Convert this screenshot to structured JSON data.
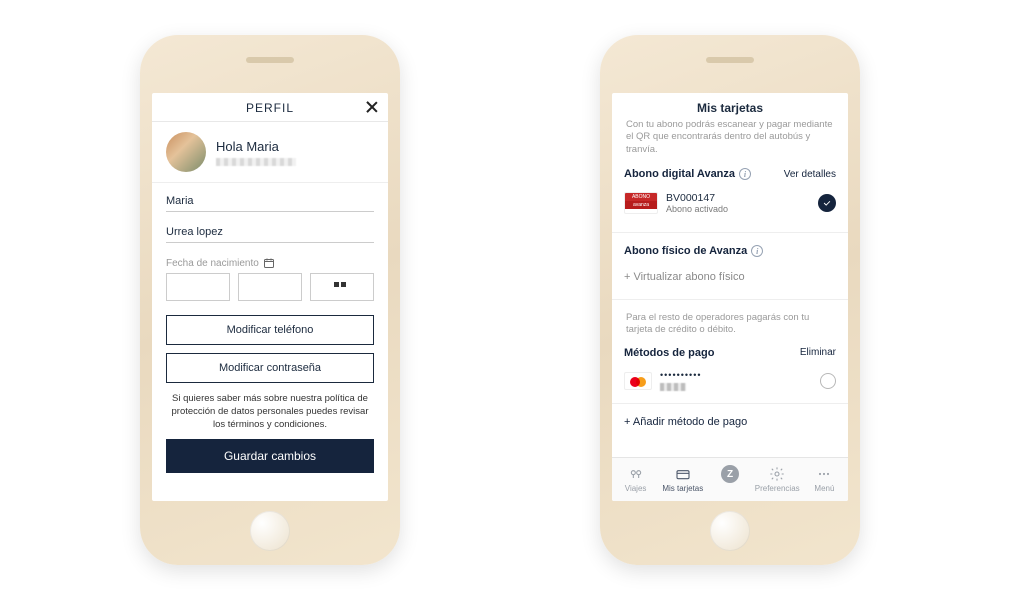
{
  "profile": {
    "title": "PERFIL",
    "greeting": "Hola Maria",
    "first_name": "Maria",
    "last_name": "Urrea lopez",
    "dob_label": "Fecha de nacimiento",
    "modify_phone": "Modificar teléfono",
    "modify_password": "Modificar contraseña",
    "policy_text": "Si quieres saber más sobre nuestra política de protección de datos personales puedes revisar los términos y condiciones.",
    "save": "Guardar cambios"
  },
  "cards": {
    "title": "Mis tarjetas",
    "subtitle": "Con tu abono podrás escanear y pagar mediante el QR que encontrarás dentro del autobús y tranvía.",
    "digital_section": "Abono digital Avanza",
    "see_details": "Ver detalles",
    "abono_code": "BV000147",
    "abono_state": "Abono activado",
    "abono_badge_top": "ABONO",
    "abono_badge_bottom": "avanza",
    "physical_section": "Abono físico de Avanza",
    "virtualize": "+ Virtualizar abono físico",
    "operators_note": "Para el resto de operadores pagarás con tu tarjeta de crédito o débito.",
    "payment_methods": "Métodos de pago",
    "delete": "Eliminar",
    "masked_dots": "••••••••••",
    "add_payment": "+ Añadir método de pago"
  },
  "tabs": {
    "viajes": "Viajes",
    "tarjetas": "Mis tarjetas",
    "z": "Z",
    "pref": "Preferencias",
    "menu": "Menú"
  }
}
